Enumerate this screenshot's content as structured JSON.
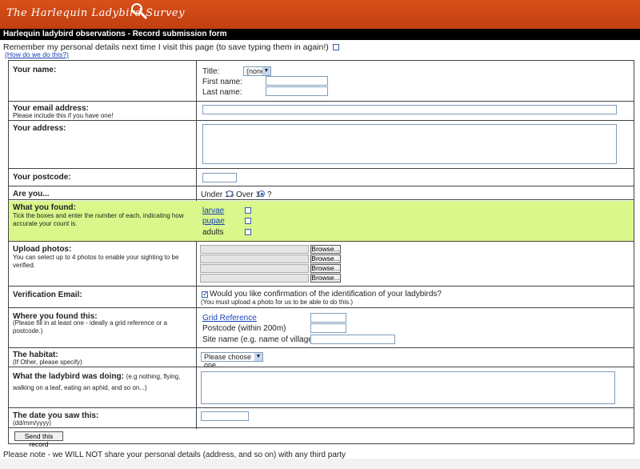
{
  "header": {
    "site_title": "The Harlequin Ladybird Survey",
    "page_title": "Harlequin ladybird observations - Record submission form"
  },
  "remember": {
    "text": "Remember my personal details next time I visit this page (to save typing them in again!)",
    "how_link": "(How do we do this?)"
  },
  "name": {
    "label": "Your name:",
    "title_label": "Title:",
    "title_value": "(none)",
    "first_label": "First name:",
    "last_label": "Last name:"
  },
  "email": {
    "label": "Your email address:",
    "sub": "Please include this if you have one!"
  },
  "address": {
    "label": "Your address:"
  },
  "postcode": {
    "label": "Your postcode:"
  },
  "age": {
    "label": "Are you...",
    "under": "Under 16",
    "over": "Over 16",
    "help": "?",
    "selected": "over"
  },
  "found": {
    "label": "What you found:",
    "sub": "Tick the boxes and enter the number of each, indicating how accurate your count is.",
    "items": [
      "larvae",
      "pupae",
      "adults"
    ]
  },
  "photos": {
    "label": "Upload photos:",
    "sub": "You can select up to 4 photos to enable your sighting to be verified.",
    "browse": "Browse..."
  },
  "verify": {
    "label": "Verification Email:",
    "question": "Would you like confirmation of the identification of your ladybirds?",
    "note": "(You must upload a photo for us to be able to do this.)"
  },
  "where": {
    "label": "Where you found this:",
    "sub": "(Please fill in at least one - ideally a grid reference or a postcode.)",
    "grid": "Grid Reference",
    "postcode": "Postcode (within 200m)",
    "site": "Site name (e.g. name of village or town)"
  },
  "habitat": {
    "label": "The habitat:",
    "sub": "(If Other, please specify)",
    "select": "Please choose one..."
  },
  "doing": {
    "label": "What the ladybird was doing:",
    "hint": "(e.g nothing, flying, walking on a leaf, eating an aphid, and so on...)"
  },
  "date": {
    "label": "The date you saw this:",
    "sub": "(dd/mm/yyyy)"
  },
  "submit": "Send this record",
  "footer": "Please note - we WILL NOT share your personal details (address, and so on) with any third party",
  "colors": {
    "banner": "#c8451a",
    "highlight": "#d9f78a"
  }
}
